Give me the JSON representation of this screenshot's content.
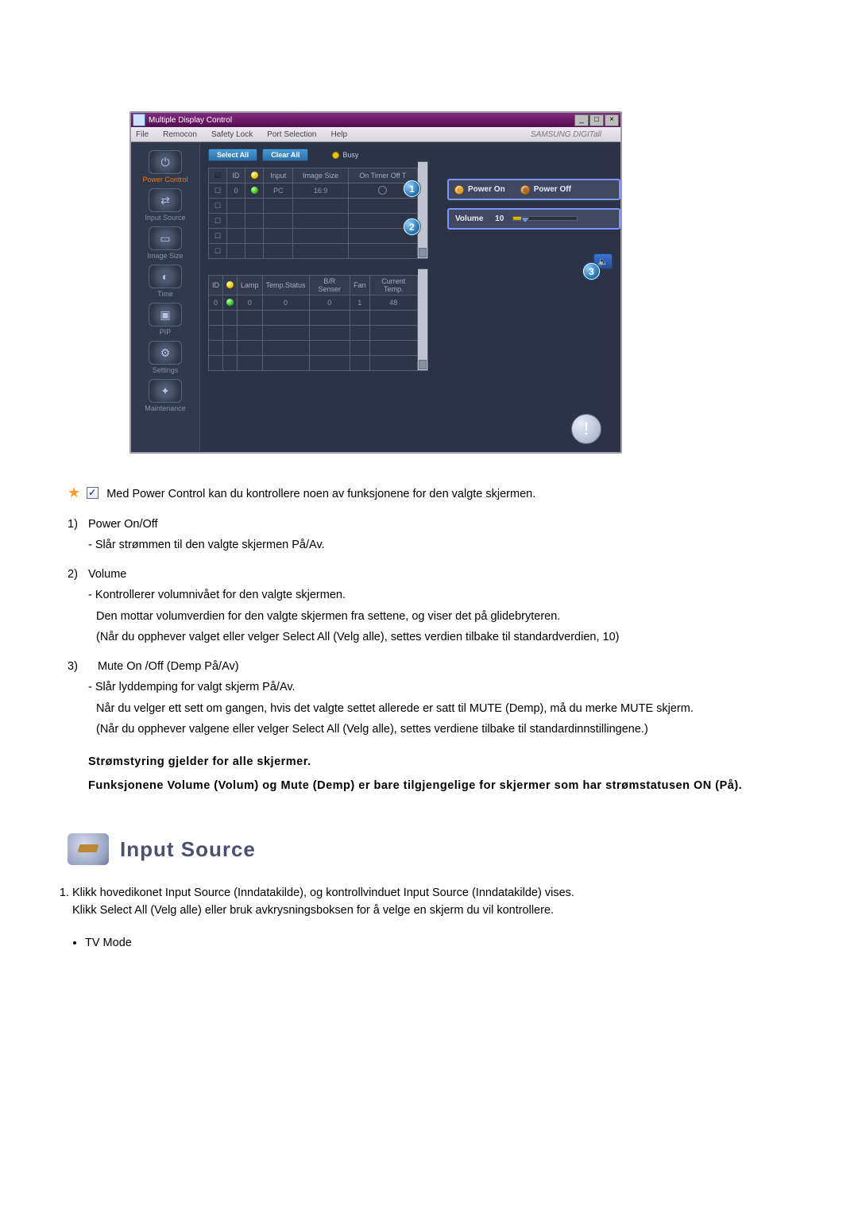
{
  "app": {
    "title": "Multiple Display Control",
    "menu": {
      "file": "File",
      "remocon": "Remocon",
      "safety": "Safety Lock",
      "port": "Port Selection",
      "help": "Help"
    },
    "brand": "SAMSUNG DIGITall"
  },
  "sidebar": {
    "power": "Power Control",
    "input": "Input Source",
    "image": "Image Size",
    "time": "Time",
    "pip": "PIP",
    "settings": "Settings",
    "maint": "Maintenance"
  },
  "toolbar": {
    "select_all": "Select All",
    "clear_all": "Clear All",
    "busy": "Busy"
  },
  "table1": {
    "h_id": "ID",
    "h_status": "",
    "h_input": "Input",
    "h_size": "Image Size",
    "h_timer": "On Timer Off T",
    "r_id": "0",
    "r_input": "PC",
    "r_size": "16:9"
  },
  "table2": {
    "h_id": "ID",
    "h_status": "",
    "h_lamp": "Lamp",
    "h_temp": "Temp.Status",
    "h_br": "B/R Senser",
    "h_fan": "Fan",
    "h_cur": "Current Temp.",
    "r_id": "0",
    "r_lamp": "0",
    "r_temp": "0",
    "r_br": "0",
    "r_fan": "1",
    "r_cur": "48"
  },
  "panel": {
    "power_on": "Power On",
    "power_off": "Power Off",
    "volume_label": "Volume",
    "volume_value": "10"
  },
  "callouts": {
    "c1": "1",
    "c2": "2",
    "c3": "3"
  },
  "doc": {
    "intro": "Med Power Control kan du kontrollere noen av funksjonene for den valgte skjermen.",
    "li1_t": "Power On/Off",
    "li1": "- Slår strømmen til den valgte skjermen På/Av.",
    "li2_t": "Volume",
    "li2a": "- Kontrollerer volumnivået for den valgte skjermen.",
    "li2b": "Den mottar volumverdien for den valgte skjermen fra settene, og viser det på glidebryteren.",
    "li2c": "(Når du opphever valget eller velger Select All (Velg alle), settes verdien tilbake til standardverdien, 10)",
    "li3_t": "Mute On /Off (Demp På/Av)",
    "li3a": "- Slår lyddemping for valgt skjerm På/Av.",
    "li3b": "Når du velger ett sett om gangen, hvis det valgte settet allerede er satt til MUTE (Demp), må du merke MUTE skjerm.",
    "li3c": "(Når du opphever valgene eller velger Select All (Velg alle), settes verdiene tilbake til standardinnstillingene.)",
    "b1": "Strømstyring gjelder for alle skjermer.",
    "b2": "Funksjonene Volume (Volum) og Mute (Demp) er bare tilgjengelige for skjermer som har strømstatusen ON (På).",
    "section": "Input Source",
    "n1": "Klikk hovedikonet Input Source (Inndatakilde), og kontrollvinduet Input Source (Inndatakilde) vises.",
    "n1b": "Klikk Select All (Velg alle) eller bruk avkrysningsboksen for å velge en skjerm du vil kontrollere.",
    "bul1": "TV Mode"
  }
}
